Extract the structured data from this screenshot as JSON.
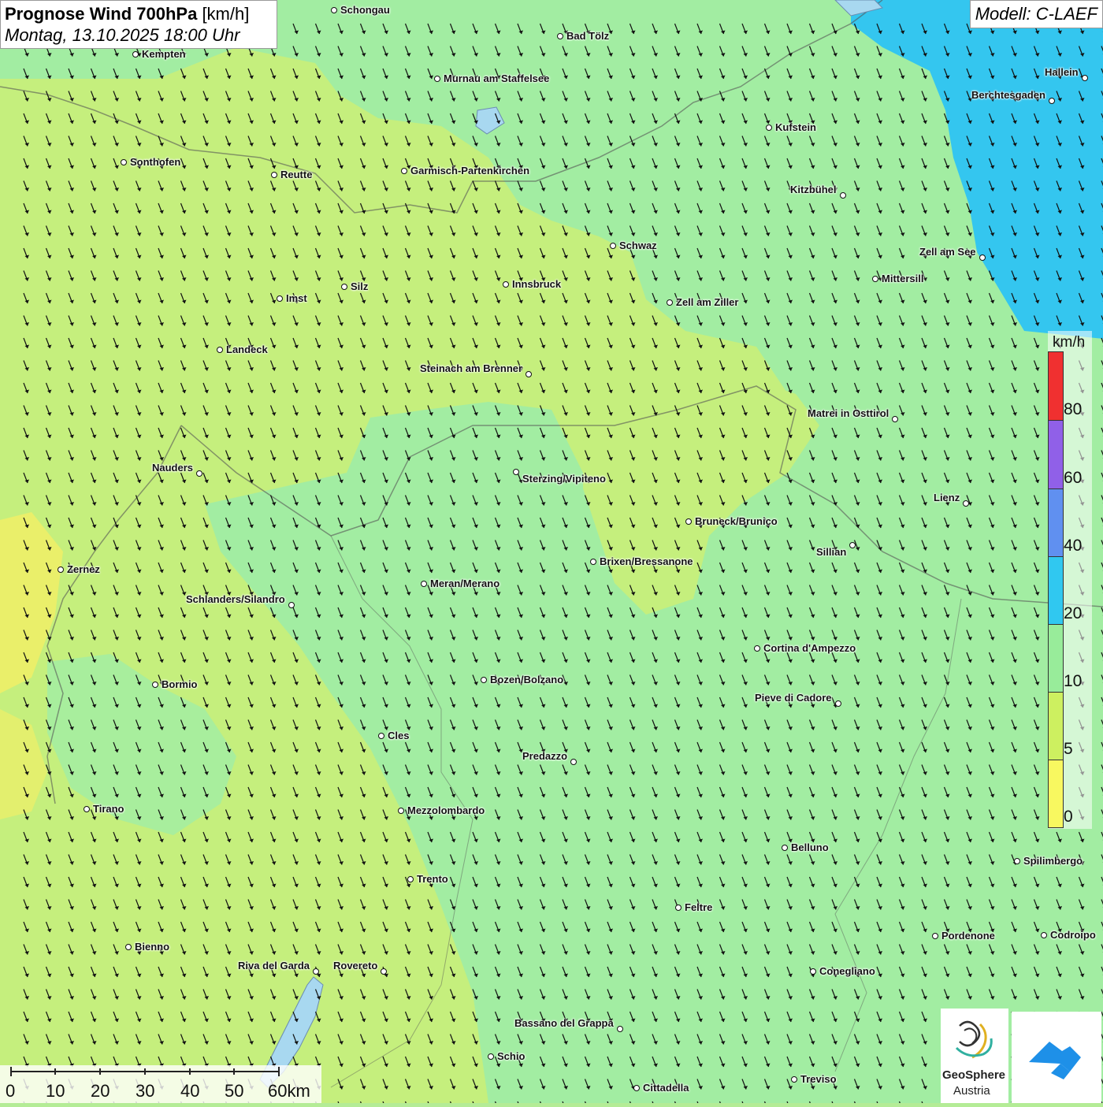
{
  "header": {
    "title_bold": "Prognose Wind 700hPa",
    "title_unit": "[km/h]",
    "subtitle": "Montag, 13.10.2025 18:00 Uhr",
    "model": "Modell: C-LAEF"
  },
  "legend": {
    "unit": "km/h",
    "labels": [
      "80",
      "60",
      "40",
      "20",
      "10",
      "5",
      "0"
    ],
    "colors": {
      "range_0_5": "#f8f860",
      "range_5_10": "#cdf060",
      "range_10_20": "#98ec9a",
      "range_20_40": "#30c8f0",
      "range_40_60": "#6090f0",
      "range_60_80": "#9060e8",
      "range_80_plus": "#f03030"
    }
  },
  "scale_bar": {
    "labels": [
      "0",
      "10",
      "20",
      "30",
      "40",
      "50",
      "60km"
    ]
  },
  "wind": {
    "direction": "north-west to south-east arrows over the whole map"
  },
  "cities": [
    {
      "name": "Schongau"
    },
    {
      "name": "Bad Tölz"
    },
    {
      "name": "Kempten"
    },
    {
      "name": "Murnau am Staffelsee"
    },
    {
      "name": "Hallein"
    },
    {
      "name": "Berchtesgaden"
    },
    {
      "name": "Kufstein"
    },
    {
      "name": "Sonthofen"
    },
    {
      "name": "Reutte"
    },
    {
      "name": "Garmisch-Partenkirchen"
    },
    {
      "name": "Kitzbühel"
    },
    {
      "name": "Schwaz"
    },
    {
      "name": "Zell am See"
    },
    {
      "name": "Mittersill"
    },
    {
      "name": "Innsbruck"
    },
    {
      "name": "Silz"
    },
    {
      "name": "Imst"
    },
    {
      "name": "Zell am Ziller"
    },
    {
      "name": "Landeck"
    },
    {
      "name": "Steinach am Brenner"
    },
    {
      "name": "Matrei in Osttirol"
    },
    {
      "name": "Nauders"
    },
    {
      "name": "Sterzing/Vipiteno"
    },
    {
      "name": "Lienz"
    },
    {
      "name": "Bruneck/Brunico"
    },
    {
      "name": "Sillian"
    },
    {
      "name": "Zernez"
    },
    {
      "name": "Brixen/Bressanone"
    },
    {
      "name": "Meran/Merano"
    },
    {
      "name": "Schlanders/Silandro"
    },
    {
      "name": "Cortina d'Ampezzo"
    },
    {
      "name": "Bozen/Bolzano"
    },
    {
      "name": "Bormio"
    },
    {
      "name": "Pieve di Cadore"
    },
    {
      "name": "Cles"
    },
    {
      "name": "Predazzo"
    },
    {
      "name": "Tirano"
    },
    {
      "name": "Mezzolombardo"
    },
    {
      "name": "Belluno"
    },
    {
      "name": "Spilimbergo"
    },
    {
      "name": "Trento"
    },
    {
      "name": "Feltre"
    },
    {
      "name": "Pordenone"
    },
    {
      "name": "Codroipo"
    },
    {
      "name": "Bienno"
    },
    {
      "name": "Riva del Garda"
    },
    {
      "name": "Rovereto"
    },
    {
      "name": "Conegliano"
    },
    {
      "name": "Bassano del Grappa"
    },
    {
      "name": "Schio"
    },
    {
      "name": "Treviso"
    },
    {
      "name": "Cittadella"
    }
  ],
  "logos": {
    "geosphere_line1": "GeoSphere",
    "geosphere_line2": "Austria"
  }
}
